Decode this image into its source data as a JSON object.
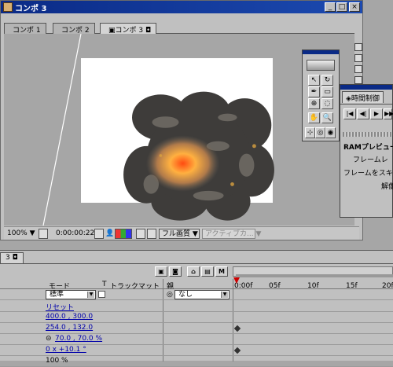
{
  "comp_window": {
    "title": "コンポ 3",
    "controls": {
      "minimize": "_",
      "maximize": "□",
      "close": "×"
    },
    "tabs": [
      "コンポ 1",
      "コンポ 2",
      "コンポ 3"
    ],
    "bottom_bar": {
      "zoom": "100%",
      "timecode": "0:00:00:22",
      "resolution": "フル画質",
      "camera": "アクティブカ..."
    }
  },
  "tools_palette": {
    "icons": [
      "selection-arrow",
      "rotate",
      "pen",
      "mask-rect",
      "pan-behind",
      "mask-oval",
      "hand",
      "zoom",
      "transform-3d",
      "orbit",
      "track"
    ]
  },
  "time_control": {
    "tab": "時間制御",
    "buttons": [
      "|◀",
      "◀|",
      "◀",
      "▶",
      "▶▶"
    ],
    "ram_preview": "RAMプレビュー",
    "frame_rate": "フレームレ",
    "skip": "フレームをスキ",
    "resolution": "解像"
  },
  "timeline": {
    "tab": "3",
    "icons": [
      "composite-icon",
      "mask-icon",
      "shy-icon",
      "frame-blend-icon",
      "motion-blur-icon"
    ],
    "motion_blur_label": "M",
    "columns": {
      "mode": "モード",
      "t": "T",
      "track_matte": "トラックマット",
      "parent": "親"
    },
    "mode_value": "標準",
    "parent_value": "なし",
    "ruler": [
      "0:00f",
      "05f",
      "10f",
      "15f",
      "20f"
    ],
    "rows": {
      "reset": "リセット",
      "anchor": "400.0 , 300.0",
      "position": "254.0 , 132.0",
      "scale": "70.0 , 70.0 %",
      "rotation": "0 x +10.1 °",
      "opacity": "100 %"
    }
  },
  "colors": {
    "titlebar": "#0a2a86",
    "panel": "#c0c0c0",
    "viewer_bg": "#a6a6a6"
  }
}
